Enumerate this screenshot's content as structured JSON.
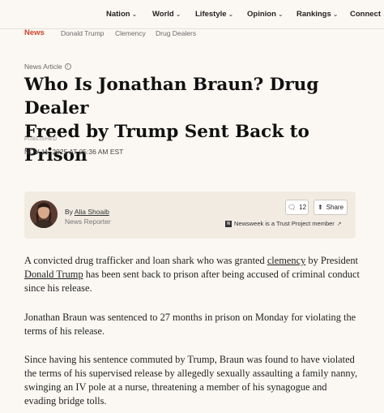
{
  "nav": {
    "items": [
      {
        "label": "Nation"
      },
      {
        "label": "World"
      },
      {
        "label": "Lifestyle"
      },
      {
        "label": "Opinion"
      },
      {
        "label": "Rankings"
      },
      {
        "label": "Connect"
      }
    ],
    "chevron": "chevron-down-icon"
  },
  "breadcrumbs": {
    "section": "News",
    "tags": [
      "Donald Trump",
      "Clemency",
      "Drug Dealers"
    ]
  },
  "article": {
    "type_label": "News Article",
    "headline_line1": "Who Is Jonathan Braun? Drug Dealer",
    "headline_line2": "Freed by Trump Sent Back to Prison",
    "published_label": "PUBLISHED",
    "published_date": "NOV 11, 2025 AT 05:36 AM EST"
  },
  "author": {
    "by": "By",
    "name": "Alia Shoaib",
    "role": "News Reporter",
    "comment_count": "12",
    "share_label": "Share",
    "trust_text": "Newsweek is a Trust Project member"
  },
  "body": {
    "p1_before_link1": "A convicted drug trafficker and loan shark who was granted ",
    "p1_link1": "clemency",
    "p1_between": " by President ",
    "p1_link2": "Donald Trump",
    "p1_after": " has been sent back to prison after being accused of criminal conduct since his release.",
    "p2": "Jonathan Braun was sentenced to 27 months in prison on Monday for violating the terms of his release.",
    "p3": "Since having his sentence commuted by Trump, Braun was found to have violated the terms of his supervised release by allegedly sexually assaulting a family nanny, swinging an IV pole at a nurse, threatening a member of his synagogue and evading bridge tolls."
  }
}
